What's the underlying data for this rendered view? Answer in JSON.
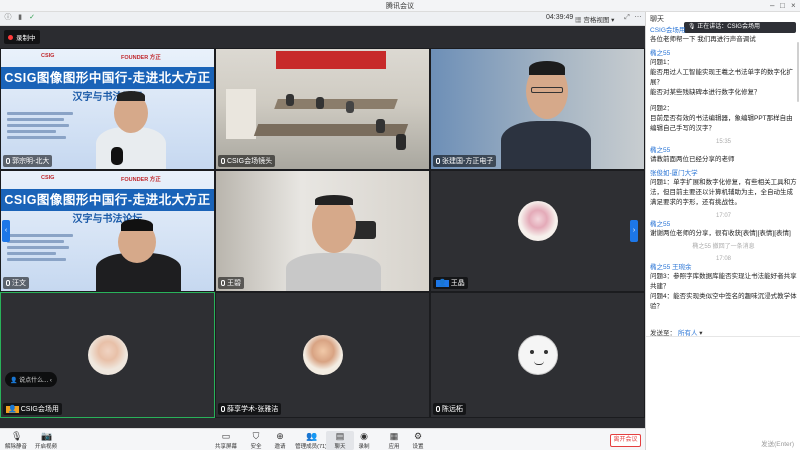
{
  "window": {
    "title": "腾讯会议"
  },
  "topbar": {
    "time": "04:39:49",
    "view_label": "宫格视图"
  },
  "stage": {
    "recording_label": "录制中",
    "tiles": [
      {
        "name": "郭宗明-北大",
        "slide_banner": "CSIG图像图形中国行-走进北大方正",
        "slide_sub": "汉字与书法论坛",
        "logo_left": "CSIG",
        "logo_right": "FOUNDER 方正"
      },
      {
        "name": "CSIG会场镜头"
      },
      {
        "name": "张建国-方正电子"
      },
      {
        "name": "汪文",
        "slide_banner": "CSIG图像图形中国行-走进北大方正",
        "slide_sub": "汉字与书法论坛",
        "logo_left": "CSIG",
        "logo_right": "FOUNDER 方正"
      },
      {
        "name": "王碧"
      },
      {
        "name": "王晶"
      },
      {
        "name": "CSIG会场用"
      },
      {
        "name": "薛享学术-张雅洁"
      },
      {
        "name": "陈远柘"
      }
    ],
    "input_tip": "说点什么..."
  },
  "toolbar": {
    "items": [
      {
        "label": "解除静音",
        "icon": "mic-icon"
      },
      {
        "label": "开启视频",
        "icon": "camera-icon"
      },
      {
        "label": "共享屏幕",
        "icon": "share-icon"
      },
      {
        "label": "安全",
        "icon": "shield-icon"
      },
      {
        "label": "邀请",
        "icon": "invite-icon"
      },
      {
        "label": "管理成员(71)",
        "icon": "members-icon"
      },
      {
        "label": "聊天",
        "icon": "chat-icon"
      },
      {
        "label": "录制",
        "icon": "record-icon"
      },
      {
        "label": "应用",
        "icon": "apps-icon"
      },
      {
        "label": "设置",
        "icon": "gear-icon"
      }
    ],
    "leave_label": "离开会议"
  },
  "chat": {
    "header": "聊天",
    "speaking": "正在讲话：CSIG会场用",
    "messages": [
      {
        "sender": "CSIG会场用",
        "lines": [
          "各位老师帮一下 我们再进行声音调试"
        ],
        "stamp": ""
      },
      {
        "sender": "椭之55",
        "lines": [
          "问题1：",
          "能否用过人工智能实现王羲之书法单字的数字化扩展？",
          "能否对某些残缺碑本进行数字化修复？",
          "",
          "问题2：",
          "目前是否有效的书法编辑器，象编辑PPT那样自由编辑自己手写的汉字？"
        ],
        "stamp": ""
      },
      {
        "sender": "椭之55",
        "lines": [
          "请教前面两位已经分享的老师"
        ],
        "stamp": "15:35"
      },
      {
        "sender": "张俊如-厦门大学",
        "lines": [
          "问题1：单字扩展和数字化修复，有些相关工具和方法，但目前主要还以计算机辅助为主，全自动生成满足要求的字形，还有挑战性。"
        ],
        "stamp": ""
      },
      {
        "sender": "椭之55",
        "lines": [
          "谢谢两位老师的分享，很有收获[表情][表情][表情]"
        ],
        "stamp": "17:07"
      },
      {
        "sender": "",
        "lines": [],
        "stamp": "椭之55 撤回了一条消息"
      },
      {
        "sender": "椭之55 王琬余",
        "lines": [
          "问题3：参照字库数据库能否实现让书法能好者共享共建？",
          "问题4：能否实现类似空中签名的趣味沉浸式教学体验？"
        ],
        "stamp": "17:08"
      }
    ],
    "send_to_label": "发送至：",
    "send_to_target": "所有人",
    "send_button": "发送(Enter)"
  }
}
